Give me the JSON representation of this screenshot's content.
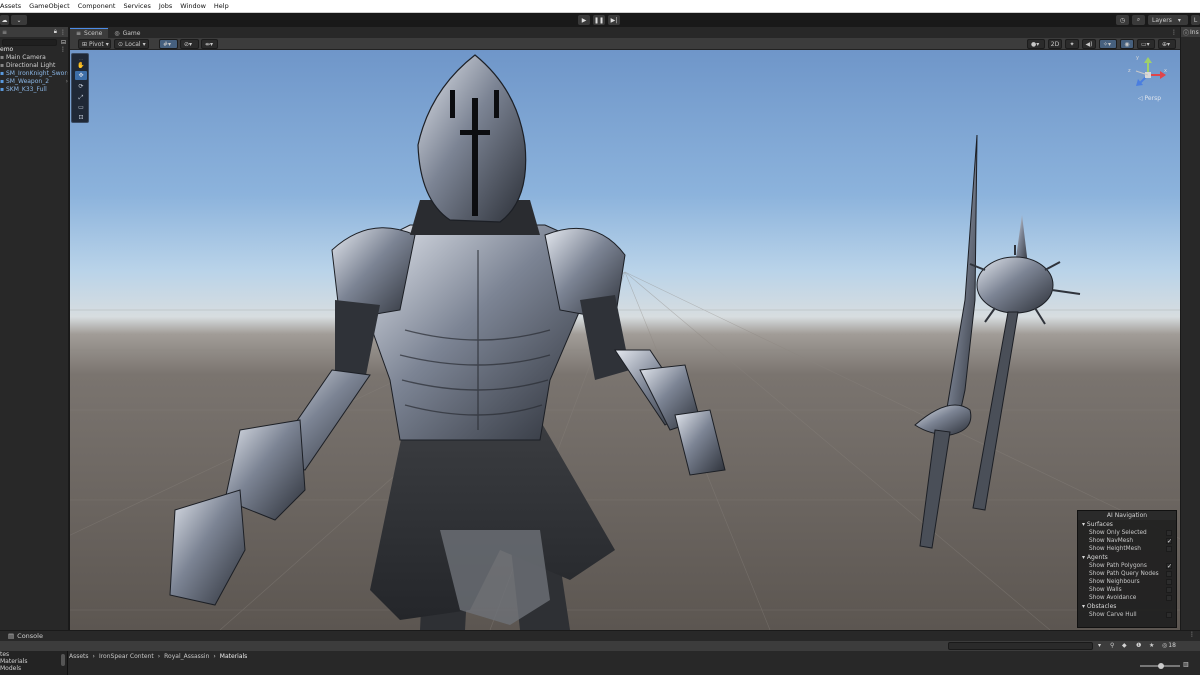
{
  "menu": [
    "Assets",
    "GameObject",
    "Component",
    "Services",
    "Jobs",
    "Window",
    "Help"
  ],
  "toolbar": {
    "layers_label": "Layers"
  },
  "hierarchy": {
    "scene_name": "emo",
    "items": [
      {
        "label": "Main Camera",
        "blue": false
      },
      {
        "label": "Directional Light",
        "blue": false
      },
      {
        "label": "SM_IronKnight_Swor",
        "blue": true
      },
      {
        "label": "SM_Weapon_2",
        "blue": true
      },
      {
        "label": "SKM_K33_Full",
        "blue": true
      }
    ]
  },
  "tabs": {
    "scene": "Scene",
    "game": "Game",
    "inspector": "Ins"
  },
  "scene_toolbar": {
    "pivot": "Pivot",
    "local": "Local",
    "mode_2d": "2D"
  },
  "gizmo": {
    "persp": "Persp",
    "x": "x",
    "y": "y",
    "z": "z"
  },
  "ai_navigation": {
    "title": "AI Navigation",
    "surfaces": {
      "label": "Surfaces",
      "options": [
        {
          "label": "Show Only Selected",
          "checked": false
        },
        {
          "label": "Show NavMesh",
          "checked": true
        },
        {
          "label": "Show HeightMesh",
          "checked": false
        }
      ]
    },
    "agents": {
      "label": "Agents",
      "options": [
        {
          "label": "Show Path Polygons",
          "checked": true
        },
        {
          "label": "Show Path Query Nodes",
          "checked": false
        },
        {
          "label": "Show Neighbours",
          "checked": false
        },
        {
          "label": "Show Walls",
          "checked": false
        },
        {
          "label": "Show Avoidance",
          "checked": false
        }
      ]
    },
    "obstacles": {
      "label": "Obstacles",
      "options": [
        {
          "label": "Show Carve Hull",
          "checked": false
        }
      ]
    }
  },
  "bottom": {
    "console_tab": "Console",
    "breadcrumb": [
      "Assets",
      "IronSpear Content",
      "Royal_Assassin",
      "Materials"
    ],
    "left_items": [
      "tes",
      "Materials",
      "Models"
    ],
    "count": "18"
  }
}
